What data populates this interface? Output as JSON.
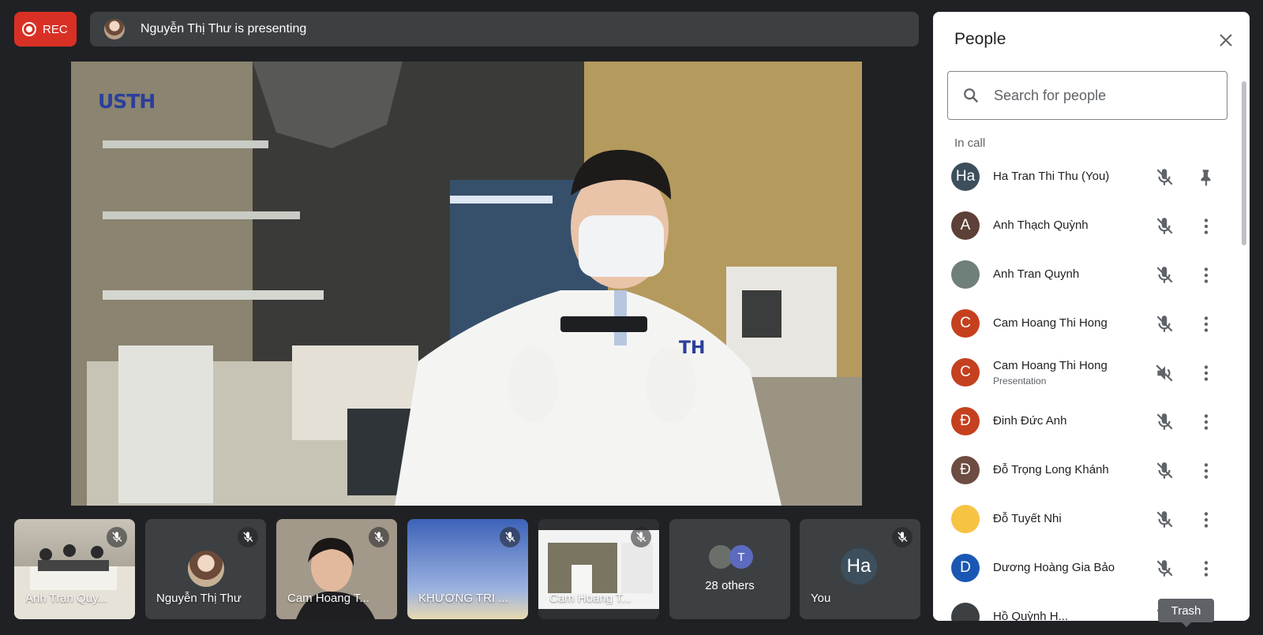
{
  "recording": {
    "label": "REC"
  },
  "presenter_bar": {
    "text": "Nguyễn Thị Thư is presenting"
  },
  "main_video": {
    "logo": "USTH"
  },
  "tiles": [
    {
      "name": "Anh Tran Quy...",
      "muted": true
    },
    {
      "name": "Nguyễn Thị Thư",
      "muted": true
    },
    {
      "name": "Cam Hoang T...",
      "muted": true
    },
    {
      "name": "KHƯƠNG TRI ...",
      "muted": true
    },
    {
      "name": "Cam Hoang T...",
      "muted": true
    },
    {
      "name": "28 others",
      "avatar_letter": "T"
    },
    {
      "name": "You",
      "avatar_initials": "Ha",
      "muted": true
    }
  ],
  "people_panel": {
    "title": "People",
    "search_placeholder": "Search for people",
    "section": "In call",
    "people": [
      {
        "name": "Ha Tran Thi Thu (You)",
        "avatar": "Ha",
        "avatar_color": "#3d4f5c",
        "action": "pin-icon"
      },
      {
        "name": "Anh Thạch Quỳnh",
        "avatar": "A",
        "avatar_color": "#5d4037",
        "action": "more-icon"
      },
      {
        "name": "Anh Tran Quynh",
        "avatar": "",
        "avatar_color": "#6f7f7a",
        "action": "more-icon"
      },
      {
        "name": "Cam Hoang Thi Hong",
        "avatar": "C",
        "avatar_color": "#c5401e",
        "action": "more-icon"
      },
      {
        "name": "Cam Hoang Thi Hong",
        "subtitle": "Presentation",
        "avatar": "C",
        "avatar_color": "#c5401e",
        "action": "more-icon",
        "presentation": true
      },
      {
        "name": "Đinh Đức Anh",
        "avatar": "Đ",
        "avatar_color": "#c5401e",
        "action": "more-icon"
      },
      {
        "name": "Đỗ Trọng Long Khánh",
        "avatar": "Đ",
        "avatar_color": "#6d4c41",
        "action": "more-icon"
      },
      {
        "name": "Đỗ Tuyết Nhi",
        "avatar": "",
        "avatar_color": "#f6c343",
        "action": "more-icon"
      },
      {
        "name": "Dương Hoàng Gia Bảo",
        "avatar": "D",
        "avatar_color": "#1a57b5",
        "action": "more-icon"
      },
      {
        "name": "Hồ Quỳnh H...",
        "avatar": "",
        "avatar_color": "#3c4043",
        "action": "more-icon"
      }
    ]
  },
  "tooltip": {
    "text": "Trash"
  }
}
